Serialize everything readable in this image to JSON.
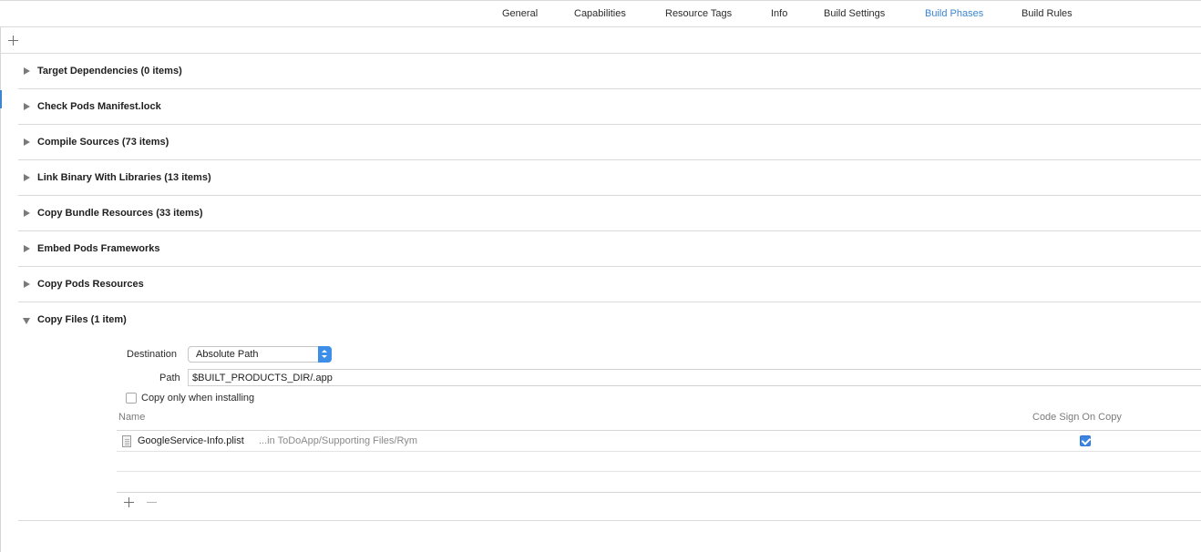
{
  "tabs": [
    {
      "label": "General",
      "active": false
    },
    {
      "label": "Capabilities",
      "active": false
    },
    {
      "label": "Resource Tags",
      "active": false
    },
    {
      "label": "Info",
      "active": false
    },
    {
      "label": "Build Settings",
      "active": false
    },
    {
      "label": "Build Phases",
      "active": true
    },
    {
      "label": "Build Rules",
      "active": false
    }
  ],
  "toolbar": {
    "add_icon": "plus-icon"
  },
  "phases": [
    {
      "title": "Target Dependencies (0 items)",
      "expanded": false
    },
    {
      "title": "Check Pods Manifest.lock",
      "expanded": false
    },
    {
      "title": "Compile Sources (73 items)",
      "expanded": false
    },
    {
      "title": "Link Binary With Libraries (13 items)",
      "expanded": false
    },
    {
      "title": "Copy Bundle Resources (33 items)",
      "expanded": false
    },
    {
      "title": "Embed Pods Frameworks",
      "expanded": false
    },
    {
      "title": "Copy Pods Resources",
      "expanded": false
    }
  ],
  "copy_files": {
    "title": "Copy Files (1 item)",
    "expanded": true,
    "destination_label": "Destination",
    "destination_value": "Absolute Path",
    "path_label": "Path",
    "path_value": "$BUILT_PRODUCTS_DIR/.app",
    "copy_only_label": "Copy only when installing",
    "copy_only_checked": false,
    "columns": {
      "name": "Name",
      "code_sign": "Code Sign On Copy"
    },
    "files": [
      {
        "name": "GoogleService-Info.plist",
        "location": "...in ToDoApp/Supporting Files/Rym",
        "code_sign_on_copy": true
      }
    ],
    "footer": {
      "add_icon": "plus-icon",
      "remove_icon": "minus-icon"
    }
  },
  "colors": {
    "accent": "#3b86d0",
    "checkbox_checked": "#3b86e3",
    "popup_arrows": "#3c8ee8"
  }
}
